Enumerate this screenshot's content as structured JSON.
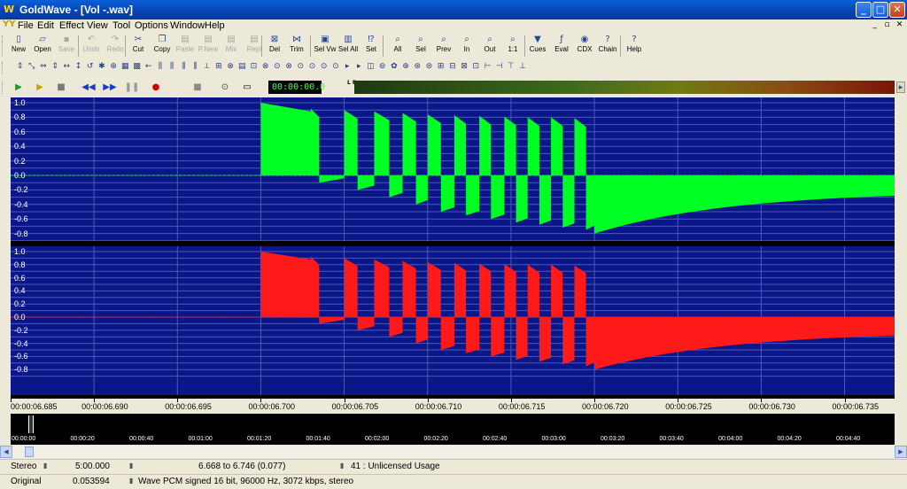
{
  "window": {
    "app_icon": "goldwave-icon",
    "title": "GoldWave - [Vol -.wav]",
    "buttons": {
      "minimize": "_",
      "maximize": "□",
      "close": "✕"
    }
  },
  "menu": {
    "logo": "YY",
    "items": [
      "File",
      "Edit",
      "Effect",
      "View",
      "Tool",
      "Options",
      "Window",
      "Help"
    ],
    "mdi_buttons": [
      "_",
      "▫",
      "✕"
    ]
  },
  "toolbar": {
    "buttons": [
      {
        "label": "New",
        "icon": "new-document-icon",
        "glyph": "▯",
        "enabled": true
      },
      {
        "label": "Open",
        "icon": "open-folder-icon",
        "glyph": "▱",
        "enabled": true
      },
      {
        "label": "Save",
        "icon": "save-icon",
        "glyph": "▪",
        "enabled": false
      },
      {
        "label": "Undo",
        "icon": "undo-icon",
        "glyph": "↶",
        "enabled": false
      },
      {
        "label": "Redo",
        "icon": "redo-icon",
        "glyph": "↷",
        "enabled": false
      },
      {
        "label": "Cut",
        "icon": "cut-icon",
        "glyph": "✂",
        "enabled": true
      },
      {
        "label": "Copy",
        "icon": "copy-icon",
        "glyph": "❐",
        "enabled": true
      },
      {
        "label": "Paste",
        "icon": "paste-icon",
        "glyph": "▤",
        "enabled": false
      },
      {
        "label": "P.New",
        "icon": "paste-new-icon",
        "glyph": "▤",
        "enabled": false
      },
      {
        "label": "Mix",
        "icon": "mix-icon",
        "glyph": "▤",
        "enabled": false
      },
      {
        "label": "Repl",
        "icon": "replace-icon",
        "glyph": "▤",
        "enabled": false
      },
      {
        "label": "Del",
        "icon": "delete-icon",
        "glyph": "⊠",
        "enabled": true
      },
      {
        "label": "Trim",
        "icon": "trim-icon",
        "glyph": "⋈",
        "enabled": true
      },
      {
        "label": "Sel Vw",
        "icon": "select-view-icon",
        "glyph": "▣",
        "enabled": true
      },
      {
        "label": "Sel All",
        "icon": "select-all-icon",
        "glyph": "▥",
        "enabled": true
      },
      {
        "label": "Set",
        "icon": "set-icon",
        "glyph": "⁉",
        "enabled": true
      },
      {
        "label": "All",
        "icon": "zoom-all-icon",
        "glyph": "⌕",
        "enabled": true
      },
      {
        "label": "Sel",
        "icon": "zoom-selection-icon",
        "glyph": "⌕",
        "enabled": true
      },
      {
        "label": "Prev",
        "icon": "zoom-previous-icon",
        "glyph": "⌕",
        "enabled": true
      },
      {
        "label": "In",
        "icon": "zoom-in-icon",
        "glyph": "⌕",
        "enabled": true
      },
      {
        "label": "Out",
        "icon": "zoom-out-icon",
        "glyph": "⌕",
        "enabled": true
      },
      {
        "label": "1:1",
        "icon": "zoom-1to1-icon",
        "glyph": "⌕",
        "enabled": true
      },
      {
        "label": "Cues",
        "icon": "cues-icon",
        "glyph": "▼",
        "enabled": true
      },
      {
        "label": "Eval",
        "icon": "eval-icon",
        "glyph": "ƒ",
        "enabled": true
      },
      {
        "label": "CDX",
        "icon": "cd-extract-icon",
        "glyph": "◉",
        "enabled": true
      },
      {
        "label": "Chain",
        "icon": "chain-icon",
        "glyph": "?",
        "enabled": true
      },
      {
        "label": "Help",
        "icon": "help-icon",
        "glyph": "?",
        "enabled": true
      }
    ]
  },
  "effects_toolbar": {
    "icons": [
      "effect-1-icon",
      "effect-2-icon",
      "effect-3-icon",
      "effect-4-icon",
      "effect-5-icon",
      "effect-6-icon",
      "effect-7-icon",
      "effect-8-icon",
      "effect-9-icon",
      "effect-10-icon",
      "effect-11-icon",
      "effect-12-icon",
      "effect-13-icon",
      "effect-14-icon",
      "effect-15-icon",
      "effect-16-icon",
      "effect-17-icon",
      "effect-18-icon",
      "effect-19-icon",
      "effect-20-icon",
      "effect-21-icon",
      "effect-22-icon",
      "effect-23-icon",
      "effect-24-icon",
      "effect-25-icon",
      "effect-26-icon",
      "effect-27-icon",
      "effect-28-icon",
      "effect-29-icon",
      "effect-30-icon",
      "effect-31-icon",
      "effect-32-icon",
      "effect-33-icon",
      "effect-34-icon",
      "effect-35-icon",
      "effect-36-icon",
      "effect-37-icon",
      "effect-38-icon",
      "effect-39-icon",
      "effect-40-icon",
      "effect-41-icon",
      "effect-42-icon",
      "effect-43-icon",
      "effect-44-icon"
    ]
  },
  "transport": {
    "buttons": [
      {
        "name": "play-icon",
        "glyph": "▶",
        "color": "#1c9a1c"
      },
      {
        "name": "play-selection-icon",
        "glyph": "▶",
        "color": "#c9a400"
      },
      {
        "name": "stop-icon",
        "glyph": "■",
        "color": "#7a7a7a"
      },
      {
        "name": "rewind-icon",
        "glyph": "◀◀",
        "color": "#1a3cc0"
      },
      {
        "name": "fast-forward-icon",
        "glyph": "▶▶",
        "color": "#1a3cc0"
      },
      {
        "name": "pause-icon",
        "glyph": "❚❚",
        "color": "#9a9a9a"
      },
      {
        "name": "record-icon",
        "glyph": "●",
        "color": "#d40000"
      },
      {
        "name": "stop-record-icon",
        "glyph": "■",
        "color": "#8a8a8a"
      },
      {
        "name": "device-controls-icon",
        "glyph": "⊙",
        "color": "#2a5a2a"
      },
      {
        "name": "display-icon",
        "glyph": "▭",
        "color": "#000000"
      }
    ],
    "time": "00:00:00.0",
    "meter_label": "L R"
  },
  "waveform": {
    "y_labels": [
      "1.0",
      "0.8",
      "0.6",
      "0.4",
      "0.2",
      "0.0",
      "-0.2",
      "-0.4",
      "-0.6",
      "-0.8"
    ],
    "background_color": "#0b1688",
    "left_channel_color": "#00ff22",
    "right_channel_color": "#ff1a1a"
  },
  "chart_data": {
    "type": "area",
    "xlabel": "",
    "ylabel": "",
    "ylim": [
      -1.0,
      1.0
    ],
    "xlim": [
      6.685,
      6.738
    ],
    "x_unit": "seconds",
    "grid": true,
    "series": [
      {
        "x": [
          6.7,
          6.703,
          6.7035,
          6.705,
          6.7058,
          6.7068,
          6.7077,
          6.7085,
          6.7093,
          6.71,
          6.7108,
          6.7116,
          6.7123,
          6.7131,
          6.7138,
          6.7146,
          6.7153,
          6.716,
          6.7167,
          6.7174,
          6.7181,
          6.7188,
          6.7195,
          6.72,
          6.738
        ],
        "y": [
          1.0,
          0.92,
          -0.1,
          0.9,
          -0.2,
          0.88,
          -0.3,
          0.86,
          -0.4,
          0.84,
          -0.5,
          0.83,
          -0.55,
          0.82,
          -0.6,
          0.81,
          -0.65,
          0.8,
          -0.68,
          0.8,
          -0.72,
          0.79,
          -0.75,
          -0.8,
          -0.28
        ]
      },
      {
        "x": [
          6.7,
          6.703,
          6.7035,
          6.705,
          6.7058,
          6.7068,
          6.7077,
          6.7085,
          6.7093,
          6.71,
          6.7108,
          6.7116,
          6.7123,
          6.7131,
          6.7138,
          6.7146,
          6.7153,
          6.716,
          6.7167,
          6.7174,
          6.7181,
          6.7188,
          6.7195,
          6.72,
          6.738
        ],
        "y": [
          1.0,
          0.92,
          -0.1,
          0.9,
          -0.2,
          0.88,
          -0.3,
          0.86,
          -0.4,
          0.84,
          -0.5,
          0.83,
          -0.55,
          0.82,
          -0.6,
          0.81,
          -0.65,
          0.8,
          -0.68,
          0.8,
          -0.72,
          0.79,
          -0.75,
          -0.8,
          -0.28
        ]
      }
    ]
  },
  "ruler": {
    "labels": [
      "00:00:06.685",
      "00:00:06.690",
      "00:00:06.695",
      "00:00:06.700",
      "00:00:06.705",
      "00:00:06.710",
      "00:00:06.715",
      "00:00:06.720",
      "00:00:06.725",
      "00:00:06.730",
      "00:00:06.735"
    ]
  },
  "overview": {
    "labels": [
      "00:00:00",
      "00:00:20",
      "00:00:40",
      "00:01:00",
      "00:01:20",
      "00:01:40",
      "00:02:00",
      "00:02:20",
      "00:02:40",
      "00:03:00",
      "00:03:20",
      "00:03:40",
      "00:04:00",
      "00:04:20",
      "00:04:40"
    ]
  },
  "status": {
    "row1": {
      "channels": "Stereo",
      "length": "5:00.000",
      "selection": "6.668 to 6.746 (0.077)",
      "license": "41 : Unlicensed Usage"
    },
    "row2": {
      "mode": "Original",
      "position": "0.053594",
      "format": "Wave PCM signed 16 bit, 96000 Hz, 3072 kbps, stereo"
    }
  }
}
